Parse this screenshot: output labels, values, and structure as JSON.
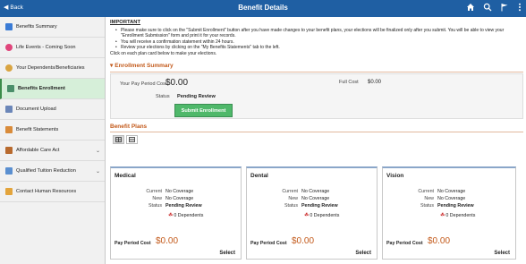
{
  "topbar": {
    "back_label": "Back",
    "title": "Benefit Details",
    "icons": [
      "home-icon",
      "search-icon",
      "flag-icon",
      "more-icon"
    ]
  },
  "sidebar": {
    "items": [
      {
        "label": "Benefits Summary",
        "icon": "summary-icon",
        "active": false,
        "chevron": false
      },
      {
        "label": "Life Events - Coming Soon",
        "icon": "life-events-icon",
        "active": false,
        "chevron": false
      },
      {
        "label": "Your Dependents/Beneficiaries",
        "icon": "dependents-icon",
        "active": false,
        "chevron": false
      },
      {
        "label": "Benefits Enrollment",
        "icon": "enrollment-icon",
        "active": true,
        "chevron": false
      },
      {
        "label": "Document Upload",
        "icon": "upload-icon",
        "active": false,
        "chevron": false
      },
      {
        "label": "Benefit Statements",
        "icon": "statements-icon",
        "active": false,
        "chevron": false
      },
      {
        "label": "Affordable Care Act",
        "icon": "aca-icon",
        "active": false,
        "chevron": true
      },
      {
        "label": "Qualified Tuition Reduction",
        "icon": "tuition-icon",
        "active": false,
        "chevron": true
      },
      {
        "label": "Contact Human Resources",
        "icon": "contact-icon",
        "active": false,
        "chevron": false
      }
    ]
  },
  "important": {
    "title": "IMPORTANT",
    "bullets": [
      "Please make sure to click on the \"Submit Enrollment\" button after you have made changes to your benefit plans, your elections will be finalized only after you submit. You will be able to view your \"Enrollment Submission\" form and print it for your records.",
      "You will receive a confirmation statement within 24 hours.",
      "Review your elections by clicking on the \"My Benefits Statements\" tab to the left."
    ],
    "click_text": "Click on each plan card below to make your elections."
  },
  "enrollment": {
    "header": "Enrollment Summary",
    "ppc_label": "Your Pay Period Cost",
    "ppc_value": "$0.00",
    "full_cost_label": "Full Cost",
    "full_cost_value": "$0.00",
    "status_label": "Status",
    "status_value": "Pending Review",
    "submit_label": "Submit Enrollment"
  },
  "plans": {
    "header": "Benefit Plans",
    "views": [
      "grid-view-icon",
      "list-view-icon"
    ],
    "cards": [
      {
        "title": "Medical",
        "current_label": "Current",
        "current": "No Coverage",
        "new_label": "New",
        "new": "No Coverage",
        "status_label": "Status",
        "status": "Pending Review",
        "dependents": "0 Dependents",
        "ppc_label": "Pay Period Cost",
        "ppc": "$0.00",
        "select": "Select"
      },
      {
        "title": "Dental",
        "current_label": "Current",
        "current": "No Coverage",
        "new_label": "New",
        "new": "No Coverage",
        "status_label": "Status",
        "status": "Pending Review",
        "dependents": "0 Dependents",
        "ppc_label": "Pay Period Cost",
        "ppc": "$0.00",
        "select": "Select"
      },
      {
        "title": "Vision",
        "current_label": "Current",
        "current": "No Coverage",
        "new_label": "New",
        "new": "No Coverage",
        "status_label": "Status",
        "status": "Pending Review",
        "dependents": "0 Dependents",
        "ppc_label": "Pay Period Cost",
        "ppc": "$0.00",
        "select": "Select"
      }
    ]
  },
  "colors": {
    "header_bg": "#1f5fa3",
    "accent_orange": "#c35a1b",
    "active_green": "#d6efd9",
    "submit_green": "#4fb86a"
  }
}
